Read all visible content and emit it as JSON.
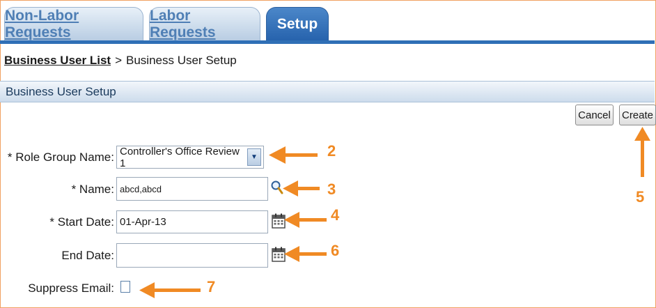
{
  "tabs": [
    {
      "label": "Non-Labor Requests",
      "active": false
    },
    {
      "label": "Labor Requests",
      "active": false
    },
    {
      "label": "Setup",
      "active": true
    }
  ],
  "breadcrumb": {
    "link": "Business User List",
    "separator": ">",
    "current": "Business User Setup"
  },
  "section": {
    "title": "Business User Setup"
  },
  "actions": {
    "cancel": "Cancel",
    "create": "Create"
  },
  "form": {
    "role_group_label": "* Role Group Name:",
    "role_group_value": "Controller's Office Review 1",
    "name_label": "* Name:",
    "name_value": "abcd,abcd",
    "start_date_label": "* Start Date:",
    "start_date_value": "01-Apr-13",
    "end_date_label": "End Date:",
    "end_date_value": "",
    "suppress_email_label": "Suppress Email:",
    "suppress_email_checked": false
  },
  "annotations": {
    "n2": "2",
    "n3": "3",
    "n4": "4",
    "n5": "5",
    "n6": "6",
    "n7": "7"
  },
  "colors": {
    "annotation": "#f08a24",
    "tab_active": "#2763ad",
    "header_text": "#1a3a5c"
  },
  "icons": {
    "search": "search-icon",
    "calendar": "calendar-icon",
    "dropdown": "chevron-down-icon"
  }
}
